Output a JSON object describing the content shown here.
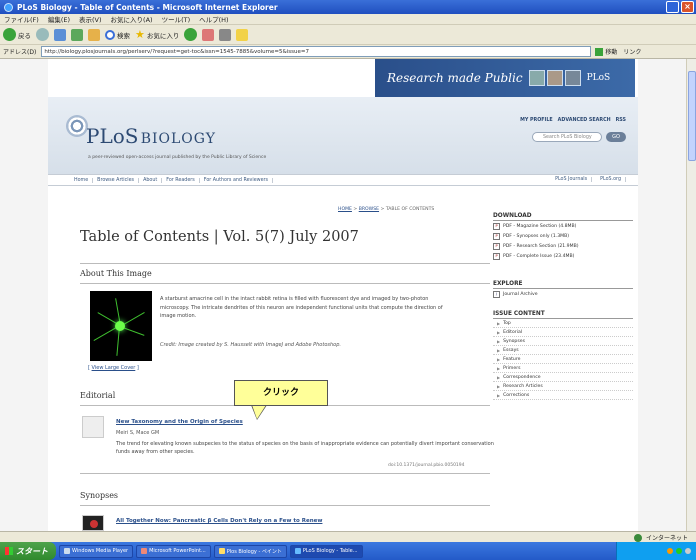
{
  "window": {
    "title": "PLoS Biology - Table of Contents - Microsoft Internet Explorer",
    "close_glyph": "×"
  },
  "menu": [
    "ファイル(F)",
    "編集(E)",
    "表示(V)",
    "お気に入り(A)",
    "ツール(T)",
    "ヘルプ(H)"
  ],
  "toolbar": {
    "back": "戻る",
    "search": "検索",
    "favorites": "お気に入り"
  },
  "address": {
    "label": "アドレス(D)",
    "url": "http://biology.plosjournals.org/perlserv/?request=get-toc&issn=1545-7885&volume=5&issue=7",
    "go": "移動",
    "links": "リンク"
  },
  "banner": {
    "tagline": "Research made Public",
    "logo": "PLoS"
  },
  "masthead": {
    "title_a": "PLoS",
    "title_b": "BIOLOGY",
    "subtitle": "a peer-reviewed open-access journal published by the Public Library of Science",
    "links": [
      "MY PROFILE",
      "ADVANCED SEARCH",
      "RSS"
    ],
    "search_placeholder": "Search PLoS Biology",
    "search_go": "GO"
  },
  "nav": {
    "items": [
      "Home",
      "Browse Articles",
      "About",
      "For Readers",
      "For Authors and Reviewers"
    ],
    "right": [
      "PLoS Journals",
      "PLoS.org"
    ]
  },
  "breadcrumb": {
    "home": "HOME",
    "browse": "BROWSE",
    "current": "TABLE OF CONTENTS",
    "sep": " > "
  },
  "page_title": "Table of Contents | Vol. 5(7) July 2007",
  "about": {
    "heading": "About This Image",
    "text": "A starburst amacrine cell in the intact rabbit retina is filled with fluorescent dye and imaged by two-photon microscopy. The intricate dendrites of this neuron are independent functional units that compute the direction of image motion.",
    "credit": "Credit: Image created by S. Hausselt with ImageJ and Adobe Photoshop.",
    "view_cover": "View Large Cover"
  },
  "editorial": {
    "heading": "Editorial",
    "title": "New Taxonomy and the Origin of Species",
    "authors": "Meiri S, Mace GM",
    "desc": "The trend for elevating known subspecies to the status of species on the basis of inappropriate evidence can potentially divert important conservation funds away from other species.",
    "doi": "doi:10.1371/journal.pbio.0050194"
  },
  "synopses": {
    "heading": "Synopses",
    "title": "All Together Now: Pancreatic β Cells Don't Rely on a Few to Renew"
  },
  "download": {
    "heading": "DOWNLOAD",
    "items": [
      "PDF - Magazine Section (4.8MB)",
      "PDF - Synopses only (1.3MB)",
      "PDF - Research Section (21.9MB)",
      "PDF - Complete Issue (23.4MB)"
    ]
  },
  "explore": {
    "heading": "EXPLORE",
    "items": [
      "Journal Archive"
    ]
  },
  "issue_content": {
    "heading": "ISSUE CONTENT",
    "items": [
      "Top",
      "Editorial",
      "Synopses",
      "Essays",
      "Feature",
      "Primers",
      "Correspondence",
      "Research Articles",
      "Corrections"
    ]
  },
  "callout": "クリック",
  "status": {
    "left": "",
    "zone": "インターネット"
  },
  "taskbar": {
    "start": "スタート",
    "tasks": [
      "Windows Media Player",
      "Microsoft PowerPoint...",
      "Plos Biology - ペイント",
      "PLoS Biology - Table..."
    ]
  },
  "colors": {
    "title_bar": "#1f4fbf",
    "link": "#2a4f8a",
    "callout": "#ffff99",
    "start": "#2f8a2d"
  }
}
